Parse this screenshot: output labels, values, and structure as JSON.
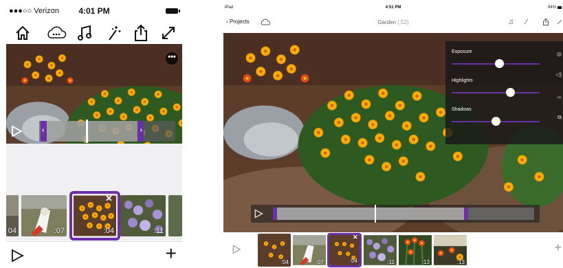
{
  "phone": {
    "status": {
      "carrier": "●●●○○ Verizon",
      "time": "4:01 PM"
    },
    "toolbar": [
      "home-icon",
      "cloud-icon",
      "music-note-icon",
      "magic-wand-icon",
      "share-icon",
      "expand-icon"
    ],
    "more_label": "•••",
    "clips": [
      {
        "duration": "04"
      },
      {
        "duration": ":07"
      },
      {
        "duration": ":04",
        "selected": true
      },
      {
        "duration": ":11"
      }
    ],
    "remove_label": "✕",
    "play_icon": "play-icon",
    "add_label": "+"
  },
  "ipad": {
    "status": {
      "device": "iPad",
      "time": "4:51 PM",
      "battery": "84%"
    },
    "nav": {
      "back_label": "Projects",
      "title": "Garden",
      "title_duration": "(:52)"
    },
    "adjustments": [
      {
        "label": "Exposure",
        "level": 0.54
      },
      {
        "label": "Highlights",
        "level": 0.66
      },
      {
        "label": "Shadows",
        "level": 0.5
      }
    ],
    "clips": [
      {
        "duration": ":04"
      },
      {
        "duration": ":07"
      },
      {
        "duration": ":04",
        "selected": true
      },
      {
        "duration": ":11"
      },
      {
        "duration": ":13"
      },
      {
        "duration": ":13"
      }
    ],
    "remove_label": "✕",
    "add_label": "+"
  },
  "colors": {
    "accent": "#6b2fa6",
    "status_bg": "#ffffff"
  }
}
